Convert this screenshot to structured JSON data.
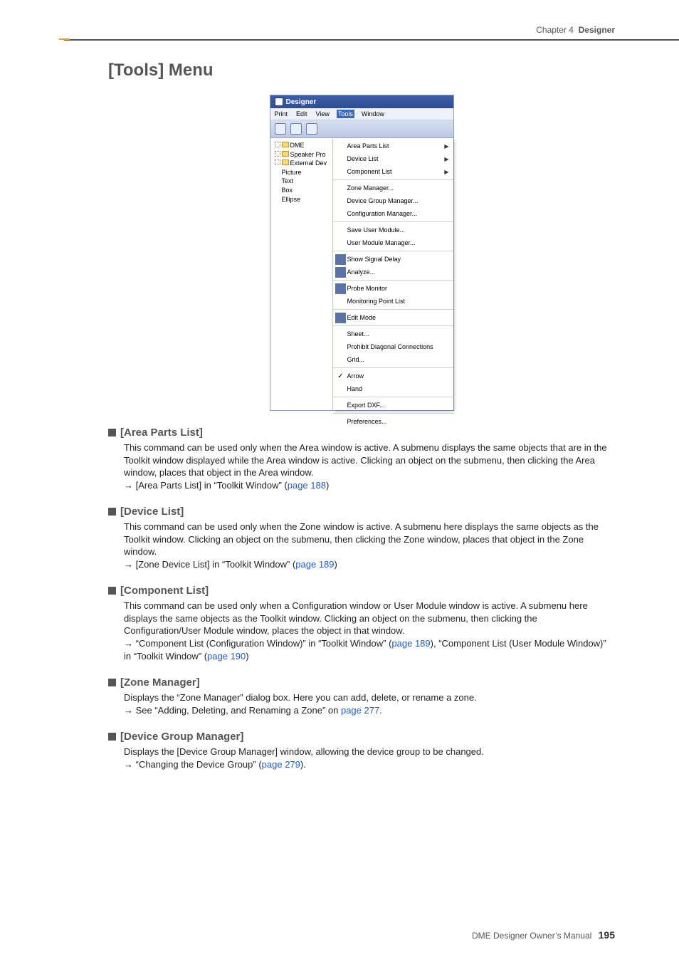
{
  "header": {
    "chapter": "Chapter 4",
    "title": "Designer"
  },
  "h1": "[Tools] Menu",
  "designer": {
    "window_title": "Designer",
    "menubar": [
      "Print",
      "Edit",
      "View",
      "Tools",
      "Window"
    ],
    "menubar_selected_index": 3,
    "tree": {
      "root": "DME",
      "children": [
        "Speaker Pro",
        "External Dev",
        "Picture",
        "Text",
        "Box",
        "Ellipse"
      ]
    },
    "tools_menu": [
      {
        "items": [
          {
            "label": "Area Parts List",
            "sub": true
          },
          {
            "label": "Device List",
            "sub": true
          },
          {
            "label": "Component List",
            "sub": true
          }
        ]
      },
      {
        "items": [
          {
            "label": "Zone Manager..."
          },
          {
            "label": "Device Group Manager..."
          },
          {
            "label": "Configuration Manager..."
          }
        ]
      },
      {
        "items": [
          {
            "label": "Save User Module..."
          },
          {
            "label": "User Module Manager..."
          }
        ]
      },
      {
        "items": [
          {
            "label": "Show Signal Delay",
            "icon": true
          },
          {
            "label": "Analyze...",
            "icon": true
          }
        ]
      },
      {
        "items": [
          {
            "label": "Probe Monitor",
            "icon": true
          },
          {
            "label": "Monitoring Point List"
          }
        ]
      },
      {
        "items": [
          {
            "label": "Edit Mode",
            "icon": true
          }
        ]
      },
      {
        "items": [
          {
            "label": "Sheet..."
          },
          {
            "label": "Prohibit Diagonal Connections"
          },
          {
            "label": "Grid..."
          }
        ]
      },
      {
        "items": [
          {
            "label": "Arrow",
            "check": true
          },
          {
            "label": "Hand"
          }
        ]
      },
      {
        "items": [
          {
            "label": "Export DXF..."
          }
        ]
      },
      {
        "items": [
          {
            "label": "Preferences..."
          }
        ]
      }
    ]
  },
  "sections": {
    "area_parts": {
      "title": "[Area Parts List]",
      "body": "This command can be used only when the Area window is active. A submenu displays the same objects that are in the Toolkit window displayed while the Area window is active. Clicking an object on the submenu, then clicking the Area window, places that object in the Area window.",
      "ref_prefix": "→ [Area Parts List] in “Toolkit Window” (",
      "ref_link": "page 188",
      "ref_suffix": ")"
    },
    "device_list": {
      "title": "[Device List]",
      "body": "This command can be used only when the Zone window is active. A submenu here displays the same objects as the Toolkit window. Clicking an object on the submenu, then clicking the Zone window, places that object in the Zone window.",
      "ref_prefix": "→ [Zone Device List] in “Toolkit Window” (",
      "ref_link": "page 189",
      "ref_suffix": ")"
    },
    "component_list": {
      "title": "[Component List]",
      "body": "This command can be used only when a Configuration window or User Module window is active. A submenu here displays the same objects as the Toolkit window. Clicking an object on the submenu, then clicking the Configuration/User Module window, places the object in that window.",
      "ref1_prefix": "→ “Component List (Configuration Window)” in “Toolkit Window” (",
      "ref1_link": "page 189",
      "ref1_mid": "), “Component List (User Module Window)” in “Toolkit Window” (",
      "ref2_link": "page 190",
      "ref_suffix": ")"
    },
    "zone_manager": {
      "title": "[Zone Manager]",
      "body": "Displays the “Zone Manager” dialog box. Here you can add, delete, or rename a zone.",
      "ref_prefix": "→ See “Adding, Deleting, and Renaming a Zone” on ",
      "ref_link": "page 277",
      "ref_suffix": "."
    },
    "device_group_manager": {
      "title": "[Device Group Manager]",
      "body": "Displays the [Device Group Manager] window, allowing the device group to be changed.",
      "ref_prefix": "→  “Changing the Device Group” (",
      "ref_link": "page 279",
      "ref_suffix": ")."
    }
  },
  "footer": {
    "manual": "DME Designer Owner’s Manual",
    "page": "195"
  }
}
